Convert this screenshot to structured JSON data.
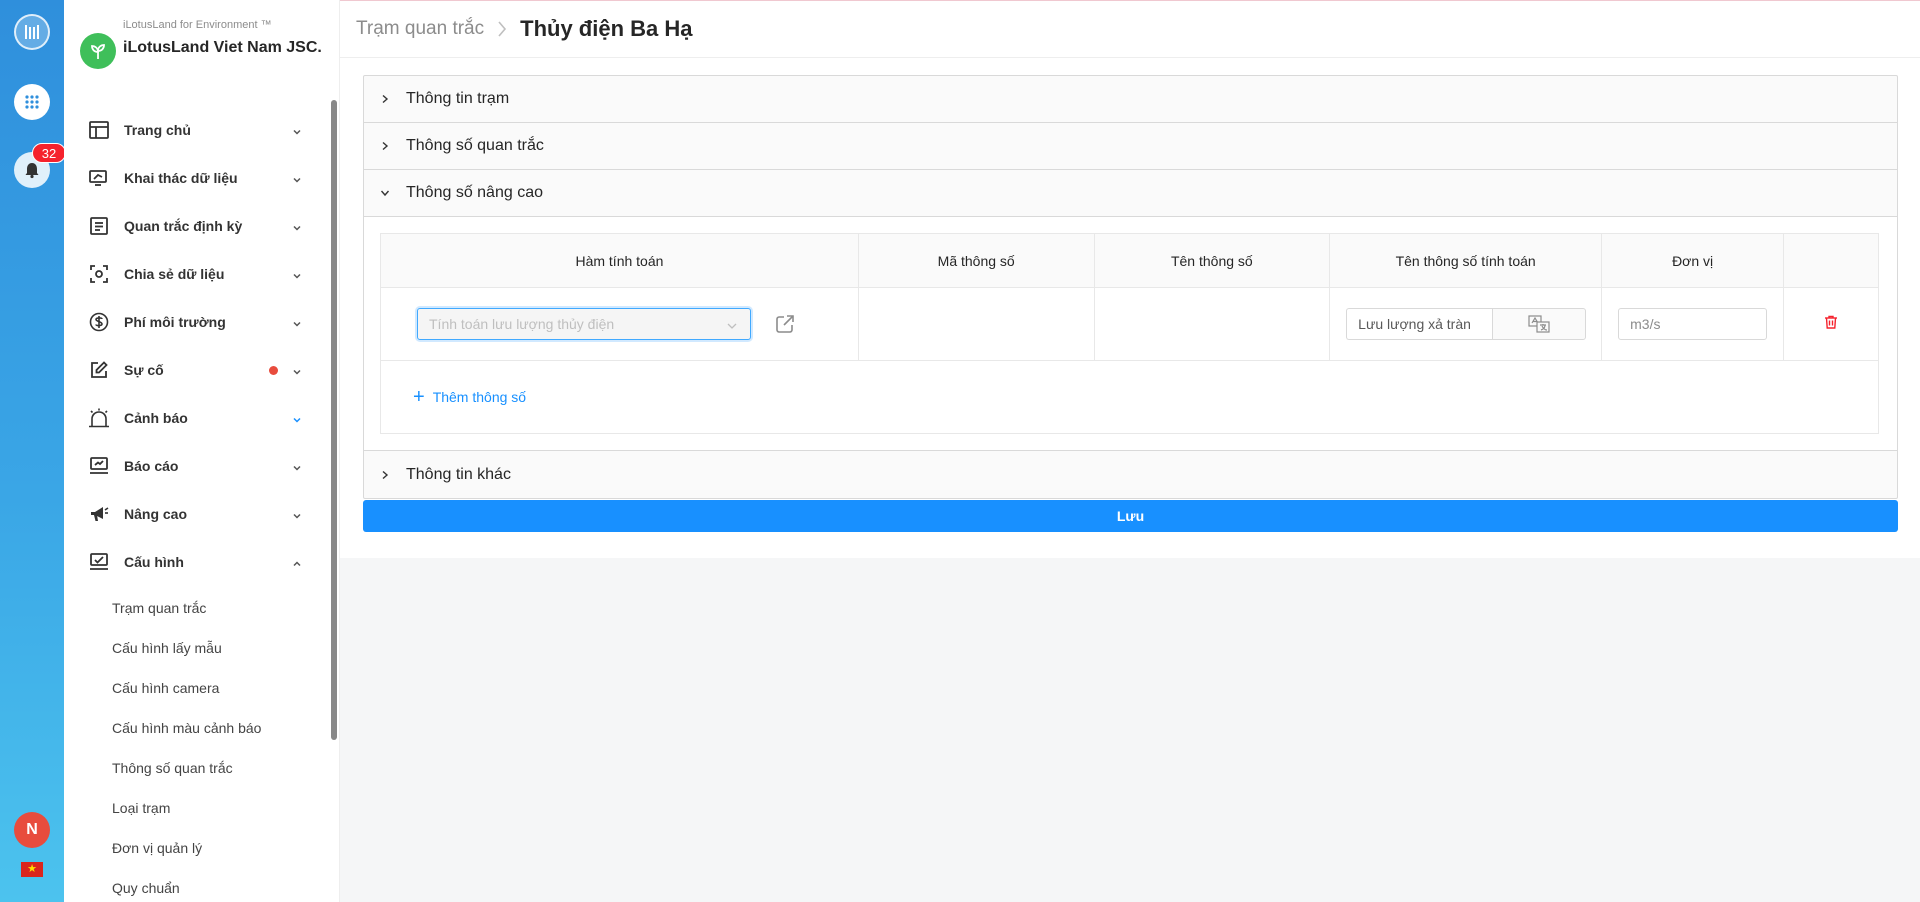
{
  "rail": {
    "notification_count": "32",
    "avatar_letter": "N",
    "flag_star": "★"
  },
  "sidebar": {
    "org_small": "iLotusLand for Environment ™",
    "org_name": "iLotusLand Viet Nam JSC.",
    "items": [
      {
        "label": "Trang chủ",
        "icon": "home-layout-icon"
      },
      {
        "label": "Khai thác dữ liệu",
        "icon": "monitor-data-icon"
      },
      {
        "label": "Quan trắc định kỳ",
        "icon": "periodic-list-icon"
      },
      {
        "label": "Chia sẻ dữ liệu",
        "icon": "share-data-icon"
      },
      {
        "label": "Phí môi trường",
        "icon": "dollar-icon"
      },
      {
        "label": "Sự cố",
        "icon": "incident-edit-icon"
      },
      {
        "label": "Cảnh báo",
        "icon": "alarm-bell-icon"
      },
      {
        "label": "Báo cáo",
        "icon": "report-icon"
      },
      {
        "label": "Nâng cao",
        "icon": "megaphone-icon"
      },
      {
        "label": "Cấu hình",
        "icon": "config-monitor-icon"
      }
    ],
    "subitems": [
      "Trạm quan trắc",
      "Cấu hình lấy mẫu",
      "Cấu hình camera",
      "Cấu hình màu cảnh báo",
      "Thông số quan trắc",
      "Loại trạm",
      "Đơn vị quản lý",
      "Quy chuẩn"
    ]
  },
  "header": {
    "breadcrumb_parent": "Trạm quan trắc",
    "breadcrumb_current": "Thủy điện Ba Hạ"
  },
  "panels": {
    "station_info": "Thông tin trạm",
    "monitoring_params": "Thông số quan trắc",
    "advanced_params": "Thông số nâng cao",
    "other_info": "Thông tin khác"
  },
  "table": {
    "headers": {
      "func": "Hàm tính toán",
      "code": "Mã thông số",
      "name": "Tên thông số",
      "calc_name": "Tên thông số tính toán",
      "unit": "Đơn vị"
    },
    "row": {
      "func_placeholder": "Tính toán lưu lượng thủy điện",
      "calc_name_value": "Lưu lượng xả tràn",
      "unit_value": "m3/s"
    },
    "add_label": "Thêm thông số"
  },
  "actions": {
    "save_label": "Lưu"
  },
  "colors": {
    "primary": "#1890ff",
    "danger": "#f5222d",
    "brand_green": "#3fbf5a"
  }
}
